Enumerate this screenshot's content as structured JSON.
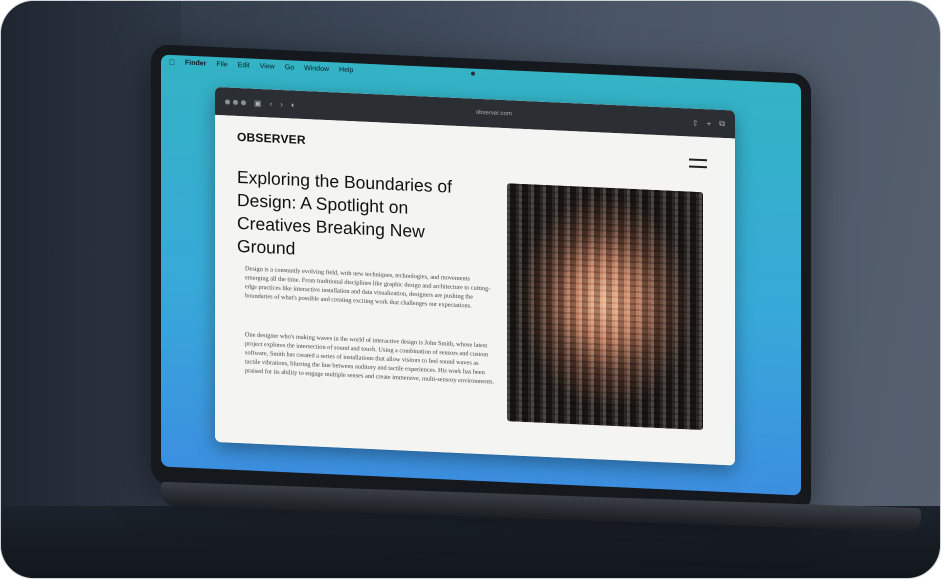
{
  "menubar": {
    "apple_icon": "apple-icon",
    "items": [
      "Finder",
      "File",
      "Edit",
      "View",
      "Go",
      "Window",
      "Help"
    ]
  },
  "browser": {
    "url": "observer.com"
  },
  "page": {
    "logo": "OBSERVER",
    "headline": "Exploring the Boundaries of Design: A Spotlight on Creatives Breaking New Ground",
    "paragraph_1": "Design is a constantly evolving field, with new techniques, technologies, and movements emerging all the time. From traditional disciplines like graphic design and architecture to cutting-edge practices like interactive installation and data visualization, designers are pushing the boundaries of what's possible and creating exciting work that challenges our expectations.",
    "paragraph_2": "One designer who's making waves in the world of interactive design is John Smith, whose latest project explores the intersection of sound and touch. Using a combination of sensors and custom software, Smith has created a series of installations that allow visitors to feel sound waves as tactile vibrations, blurring the line between auditory and tactile experiences. His work has been praised for its ability to engage multiple senses and create immersive, multi-sensory environments."
  }
}
